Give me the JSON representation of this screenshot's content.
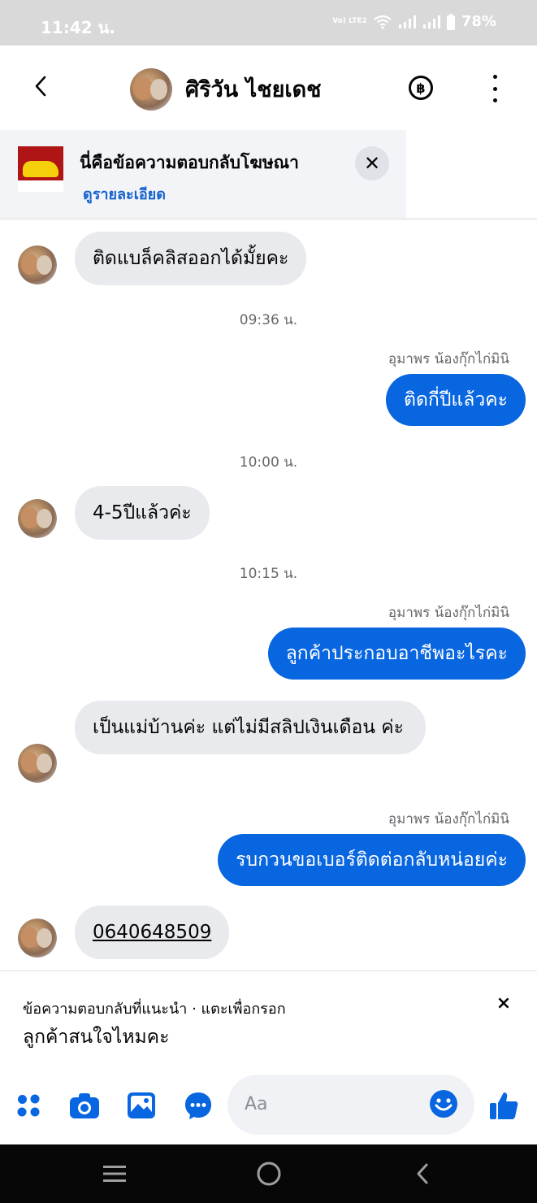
{
  "status_bar": {
    "time": "11:42 น.",
    "network_label": "Vo) LTE2",
    "battery": "78%",
    "icons": [
      "wifi-icon",
      "signal-icon",
      "signal-icon",
      "battery-icon"
    ]
  },
  "header": {
    "contact_name": "ศิริวัน ไชยเดช",
    "icons": [
      "back-arrow-icon",
      "avatar",
      "baht-icon",
      "more-vertical-icon"
    ]
  },
  "ad_banner": {
    "title": "นี่คือข้อความตอบกลับโฆษณา",
    "link": "ดูรายละเอียด",
    "close_icon": "close-icon"
  },
  "messages": [
    {
      "type": "in",
      "text": "ติดแบล็คลิสออกได้มั้ยคะ"
    },
    {
      "type": "time",
      "text": "09:36 น."
    },
    {
      "type": "sender",
      "text": "อุมาพร น้องกุ๊กไก่มินิ"
    },
    {
      "type": "out",
      "text": "ติดกี่ปีแล้วคะ"
    },
    {
      "type": "time",
      "text": "10:00 น."
    },
    {
      "type": "in",
      "text": "4-5ปีแล้วค่ะ"
    },
    {
      "type": "time",
      "text": "10:15 น."
    },
    {
      "type": "sender",
      "text": "อุมาพร น้องกุ๊กไก่มินิ"
    },
    {
      "type": "out",
      "text": "ลูกค้าประกอบอาชีพอะไรคะ"
    },
    {
      "type": "in",
      "text": "เป็นแม่บ้านค่ะ แต่ไม่มีสลิปเงินเดือน ค่ะ"
    },
    {
      "type": "sender",
      "text": "อุมาพร น้องกุ๊กไก่มินิ"
    },
    {
      "type": "out",
      "text": "รบกวนขอเบอร์ติดต่อกลับหน่อยค่ะ"
    },
    {
      "type": "in",
      "text": "0640648509"
    }
  ],
  "suggestion": {
    "label": "ข้อความตอบกลับที่แนะนำ · แตะเพื่อกรอก",
    "text": "ลูกค้าสนใจไหมคะ",
    "close": "×"
  },
  "composer": {
    "placeholder": "Aa",
    "icons": [
      "apps-grid-icon",
      "camera-icon",
      "gallery-icon",
      "chat-bubble-icon",
      "emoji-icon",
      "thumbs-up-icon"
    ]
  },
  "nav_bar": {
    "icons": [
      "recents-icon",
      "home-icon",
      "back-icon"
    ]
  },
  "colors": {
    "accent": "#0866e1",
    "incoming_bubble": "#e9eaed",
    "link": "#1763cf",
    "muted_text": "#65676b",
    "status_bar": "#d9d9d9",
    "nav_bar": "#070707"
  }
}
